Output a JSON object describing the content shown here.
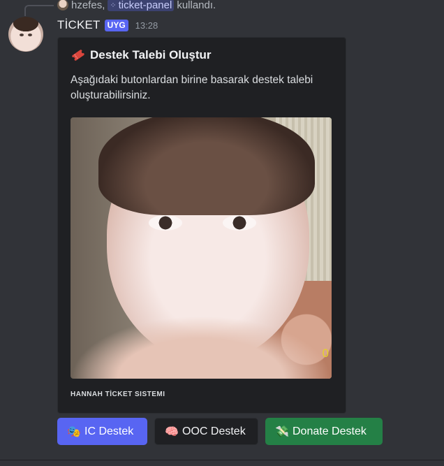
{
  "reply": {
    "user": "hzefes,",
    "command": "ticket-panel",
    "suffix": "kullandı."
  },
  "message": {
    "author": "TİCKET",
    "badge": "UYG",
    "time": "13:28"
  },
  "embed": {
    "title": "Destek Talebi Oluştur",
    "description": "Aşağıdaki butonlardan birine basarak destek talebi oluşturabilirsiniz.",
    "image_overlay_text": "0",
    "footer": "HANNAH TİCKET SISTEMI"
  },
  "buttons": [
    {
      "emoji": "🎭",
      "label": "IC Destek",
      "color": "#5865f2"
    },
    {
      "emoji": "🧠",
      "label": "OOC Destek",
      "color": "#1f2023"
    },
    {
      "emoji": "💸",
      "label": "Donate Destek",
      "color": "#248046"
    }
  ],
  "icons": {
    "ticket": "ticket-icon",
    "command": "slash-command-icon"
  }
}
